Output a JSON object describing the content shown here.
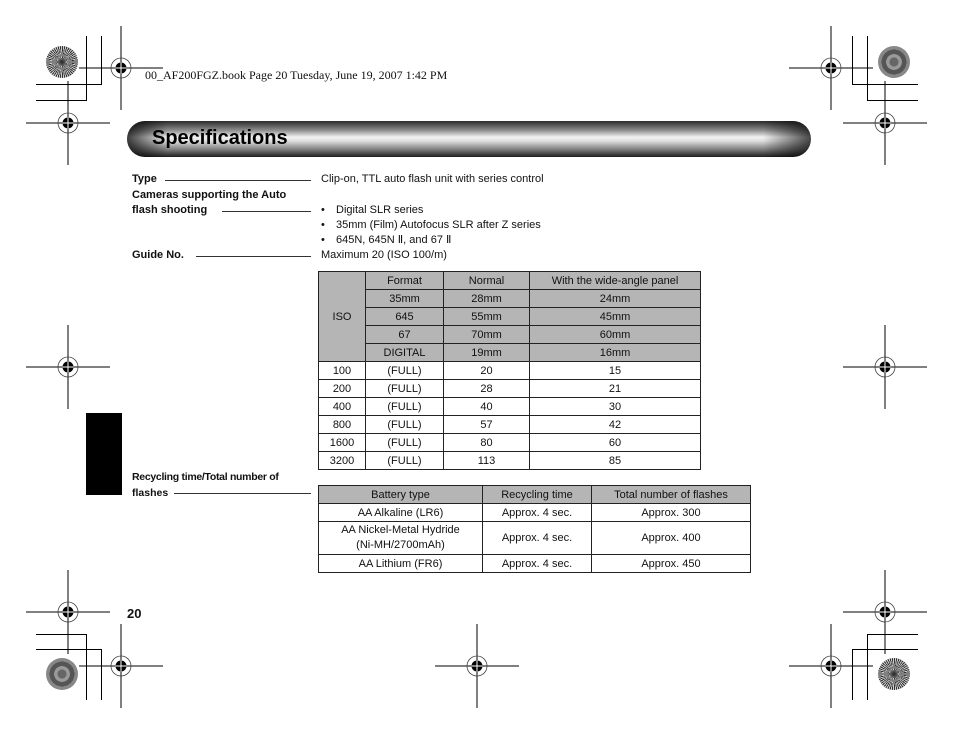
{
  "book_header": "00_AF200FGZ.book  Page 20  Tuesday, June 19, 2007  1:42 PM",
  "title": "Specifications",
  "specs": {
    "type": {
      "label": "Type",
      "value": "Clip-on, TTL auto flash unit with series control"
    },
    "cameras": {
      "label_line1": "Cameras supporting the Auto",
      "label_line2": "flash shooting",
      "items": [
        "Digital SLR series",
        "35mm (Film) Autofocus SLR after Z series",
        "645N, 645N Ⅱ, and 67 Ⅱ"
      ]
    },
    "guide_no": {
      "label": "Guide No.",
      "value": "Maximum 20 (ISO 100/m)"
    },
    "recycling": {
      "label_line1": "Recycling time/Total number of",
      "label_line2": "flashes"
    }
  },
  "guide_table": {
    "iso_label": "ISO",
    "headers": [
      "Format",
      "Normal",
      "With the wide-angle panel"
    ],
    "formats": [
      [
        "35mm",
        "28mm",
        "24mm"
      ],
      [
        "645",
        "55mm",
        "45mm"
      ],
      [
        "67",
        "70mm",
        "60mm"
      ],
      [
        "DIGITAL",
        "19mm",
        "16mm"
      ]
    ],
    "rows": [
      [
        "100",
        "(FULL)",
        "20",
        "15"
      ],
      [
        "200",
        "(FULL)",
        "28",
        "21"
      ],
      [
        "400",
        "(FULL)",
        "40",
        "30"
      ],
      [
        "800",
        "(FULL)",
        "57",
        "42"
      ],
      [
        "1600",
        "(FULL)",
        "80",
        "60"
      ],
      [
        "3200",
        "(FULL)",
        "113",
        "85"
      ]
    ]
  },
  "battery_table": {
    "headers": [
      "Battery type",
      "Recycling time",
      "Total number of flashes"
    ],
    "rows": [
      [
        "AA Alkaline (LR6)",
        "Approx. 4 sec.",
        "Approx. 300"
      ],
      [
        "AA Nickel-Metal Hydride\n(Ni-MH/2700mAh)",
        "Approx. 4 sec.",
        "Approx. 400"
      ],
      [
        "AA Lithium (FR6)",
        "Approx. 4 sec.",
        "Approx. 450"
      ]
    ]
  },
  "page_number": "20"
}
